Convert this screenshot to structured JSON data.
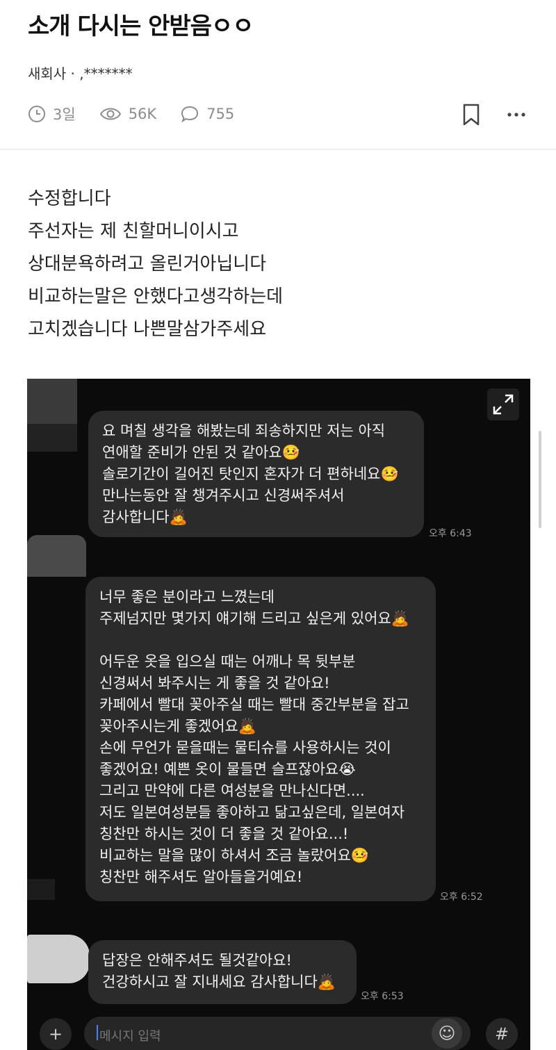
{
  "post": {
    "title": "소개 다시는 안받음ㅇㅇ",
    "author": "새회사 · ,*******",
    "meta": {
      "time": "3일",
      "views": "56K",
      "comments": "755"
    }
  },
  "body_lines": [
    "수정합니다",
    "주선자는 제 친할머니이시고",
    "상대분욕하려고 올린거아닙니다",
    "비교하는말은 안했다고생각하는데",
    "고치겠습니다 나쁜말삼가주세요"
  ],
  "chat": {
    "messages": [
      {
        "lines": [
          "요 며칠 생각을 해봤는데 죄송하지만 저는 아직",
          "연애할 준비가 안된 것 같아요🤒",
          "솔로기간이 길어진 탓인지 혼자가 더 편하네요🤒",
          "만나는동안 잘 챙겨주시고 신경써주셔서",
          "감사합니다🙇"
        ],
        "time": "오후 6:43"
      },
      {
        "lines": [
          "너무 좋은 분이라고 느꼈는데",
          "주제넘지만 몇가지 얘기해 드리고 싶은게 있어요🙇",
          "",
          "어두운 옷을 입으실 때는 어깨나 목 뒷부분",
          "신경써서 봐주시는 게 좋을 것 같아요!",
          "카페에서 빨대 꽂아주실 때는 빨대 중간부분을 잡고",
          "꽂아주시는게 좋겠어요🙇",
          "손에 무언가 묻을때는 물티슈를 사용하시는 것이",
          "좋겠어요! 예쁜 옷이 물들면 슬프잖아요😭",
          "그리고 만약에 다른 여성분을 만나신다면....",
          "저도 일본여성분들 좋아하고 닮고싶은데, 일본여자",
          "칭찬만 하시는 것이 더 좋을 것 같아요...!",
          "비교하는 말을 많이 하셔서 조금 놀랐어요🤒",
          "칭찬만 해주셔도 알아들을거예요!"
        ],
        "time": "오후 6:52"
      },
      {
        "lines": [
          "답장은 안해주셔도 될것같아요!",
          "건강하시고 잘 지내세요 감사합니다🙇"
        ],
        "time": "오후 6:53"
      }
    ],
    "input_placeholder": "메시지 입력",
    "icons": [
      "plus-icon",
      "emoji-icon",
      "hash-icon",
      "expand-icon"
    ]
  }
}
